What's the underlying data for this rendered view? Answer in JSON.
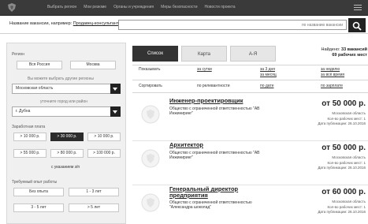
{
  "topnav": {
    "items": [
      "Выбрать регион",
      "Мои резюме",
      "Органы и учреждения",
      "Меры безопасности",
      "Новости проекта"
    ]
  },
  "search": {
    "label": "Название вакансии, например:",
    "example": "Продавец-консультант",
    "placeholder": "по названию вакансии"
  },
  "sidebar": {
    "region_title": "Регион",
    "region_all": "Вся Россия",
    "region_moscow": "Москва",
    "region_hint": "Вы можете выбрать другие регионы",
    "region_select": "Московская область",
    "city_hint": "уточните город или район",
    "city_select": "г. Дубна",
    "salary_title": "Заработная плата",
    "salary": [
      "> 10 000 р.",
      "> 30 000 р.",
      "> 10 000 р.",
      "> 55 000 р.",
      "> 80 000 р.",
      "> 100 000 р."
    ],
    "salary_note": "с указанием з/п",
    "exp_title": "Требуемый опыт работы",
    "exp": [
      "Без опыта",
      "1 - 3 лет",
      "3 - 5 лет",
      "> 5 лет"
    ]
  },
  "tabs": [
    "Список",
    "Карта",
    "А-Я"
  ],
  "found": {
    "prefix": "Найдено:",
    "vacancies": "33 вакансий",
    "places": "69 рабочих мест"
  },
  "filters": {
    "show_label": "Показывать",
    "show_options": [
      "за сутки",
      "за 3 дня",
      "за месяц",
      "за неделю",
      "за всё время"
    ],
    "sort_label": "Сортировать",
    "sort_options": [
      "по релевантности",
      "по дате",
      "по зарплате"
    ]
  },
  "vacancies": [
    {
      "title": "Инженер-проектировщик",
      "org": "Общество с ограниченной ответственностью \"АВ Инжиниринг\"",
      "salary": "от 50 000 р.",
      "region": "Московская область",
      "places": "Кол-во рабочих мест: 1",
      "date": "Дата публикации: 26.10.2016"
    },
    {
      "title": "Архитектор",
      "org": "Общество с ограниченной ответственностью \"АВ Инжиниринг\"",
      "salary": "от 50 000 р.",
      "region": "Московская область",
      "places": "Кол-во рабочих мест: 1",
      "date": "Дата публикации: 26.10.2016"
    },
    {
      "title": "Генеральный директор предприятия",
      "org": "Общество с ограниченной ответственностью \"Александра шоколад\"",
      "salary": "от 60 000 р.",
      "region": "Московская область",
      "places": "Кол-во рабочих мест: 1",
      "date": "Дата публикации: 26.10.2016"
    }
  ]
}
